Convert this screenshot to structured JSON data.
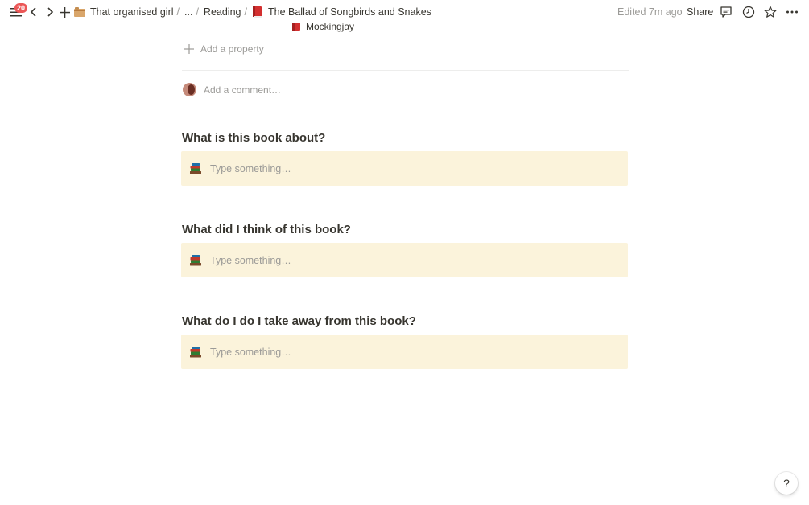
{
  "topbar": {
    "notification_count": "20",
    "breadcrumbs": [
      {
        "label": "That organised girl",
        "icon": "folder-emoji-icon"
      },
      {
        "label": "..."
      },
      {
        "label": "Reading"
      },
      {
        "label": "The Ballad of Songbirds and Snakes",
        "icon": "red-book-emoji-icon"
      }
    ],
    "edited": "Edited 7m ago",
    "share": "Share"
  },
  "properties": {
    "partial_value": "Mockingjay",
    "add_property": "Add a property"
  },
  "comment": {
    "placeholder": "Add a comment…"
  },
  "sections": [
    {
      "heading": "What is this book about?",
      "placeholder": "Type something…"
    },
    {
      "heading": "What did I think of this book?",
      "placeholder": "Type something…"
    },
    {
      "heading": "What do I do I take away from this book?",
      "placeholder": "Type something…"
    }
  ],
  "help": "?",
  "colors": {
    "callout_bg": "#fbf3db",
    "text": "#37352f",
    "muted": "#9b9a97",
    "badge": "#eb5757"
  }
}
